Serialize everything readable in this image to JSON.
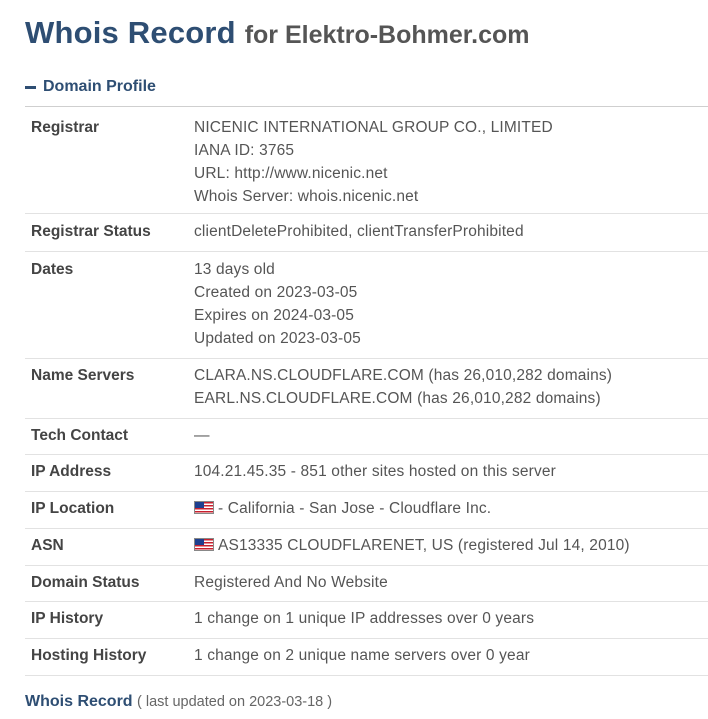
{
  "header": {
    "title": "Whois Record",
    "subtitle": "for Elektro-Bohmer.com"
  },
  "section": {
    "label": "Domain Profile"
  },
  "profile": {
    "registrar": {
      "label": "Registrar",
      "name": "NICENIC INTERNATIONAL GROUP CO., LIMITED",
      "iana": "IANA ID: 3765",
      "url": "URL: http://www.nicenic.net",
      "whois_server": "Whois Server: whois.nicenic.net"
    },
    "registrar_status": {
      "label": "Registrar Status",
      "value": "clientDeleteProhibited, clientTransferProhibited"
    },
    "dates": {
      "label": "Dates",
      "age": "13 days old",
      "created": "Created on 2023-03-05",
      "expires": "Expires on 2024-03-05",
      "updated": "Updated on 2023-03-05"
    },
    "name_servers": {
      "label": "Name Servers",
      "servers": [
        "CLARA.NS.CLOUDFLARE.COM (has 26,010,282 domains)",
        "EARL.NS.CLOUDFLARE.COM (has 26,010,282 domains)"
      ]
    },
    "tech_contact": {
      "label": "Tech Contact",
      "value": "—"
    },
    "ip_address": {
      "label": "IP Address",
      "value": "104.21.45.35 - 851 other sites hosted on this server"
    },
    "ip_location": {
      "label": "IP Location",
      "value": "- California - San Jose - Cloudflare Inc.",
      "flag_icon": "us-flag-icon"
    },
    "asn": {
      "label": "ASN",
      "value": "AS13335 CLOUDFLARENET, US (registered Jul 14, 2010)",
      "flag_icon": "us-flag-icon"
    },
    "domain_status": {
      "label": "Domain Status",
      "value": "Registered And No Website"
    },
    "ip_history": {
      "label": "IP History",
      "value": "1 change on 1 unique IP addresses over 0 years"
    },
    "hosting_history": {
      "label": "Hosting History",
      "value": "1 change on 2 unique name servers over 0 year"
    }
  },
  "footer": {
    "title": "Whois Record",
    "updated": "( last updated on 2023-03-18 )"
  },
  "colors": {
    "heading": "#2e4e73",
    "text": "#555555",
    "label": "#444444"
  }
}
